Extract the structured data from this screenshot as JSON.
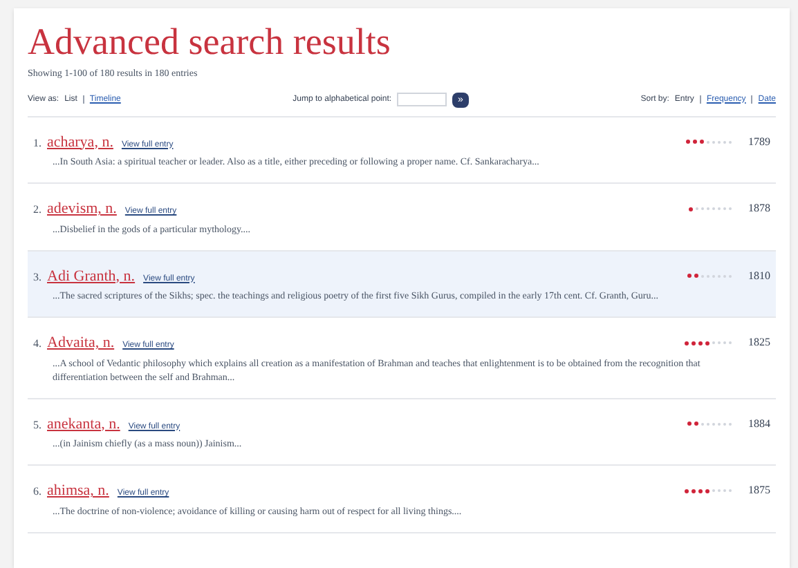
{
  "title": "Advanced search results",
  "summary": "Showing 1-100 of 180 results in 180 entries",
  "view": {
    "label": "View as:",
    "options": [
      {
        "label": "List",
        "selected": true
      },
      {
        "label": "Timeline",
        "selected": false
      }
    ]
  },
  "jump": {
    "label": "Jump to alphabetical point:",
    "button": "»"
  },
  "sort": {
    "label": "Sort by:",
    "options": [
      {
        "label": "Entry",
        "selected": true
      },
      {
        "label": "Frequency",
        "selected": false
      },
      {
        "label": "Date",
        "selected": false
      }
    ]
  },
  "results": [
    {
      "number": "1.",
      "headword": "acharya, n.",
      "link": "View full entry",
      "snippet": "...In South Asia: a spiritual teacher or leader. Also as a title, either preceding or following a proper name. Cf. Sankaracharya...",
      "level": 0.375,
      "date": "1789",
      "highlighted": false
    },
    {
      "number": "2.",
      "headword": "adevism, n.",
      "link": "View full entry",
      "snippet": "...Disbelief in the gods of a particular mythology....",
      "level": 0.125,
      "date": "1878",
      "highlighted": false
    },
    {
      "number": "3.",
      "headword": "Adi Granth, n.",
      "link": "View full entry",
      "snippet": "...The sacred scriptures of the Sikhs; spec. the teachings and religious poetry of the first five Sikh Gurus, compiled in the early 17th cent. Cf. Granth, Guru...",
      "level": 0.25,
      "date": "1810",
      "highlighted": true
    },
    {
      "number": "4.",
      "headword": "Advaita, n.",
      "link": "View full entry",
      "snippet": "...A school of Vedantic philosophy which explains all creation as a manifestation of Brahman and teaches that enlightenment is to be obtained from the recognition that differentiation between the self and Brahman...",
      "level": 0.5,
      "date": "1825",
      "highlighted": false
    },
    {
      "number": "5.",
      "headword": "anekanta, n.",
      "link": "View full entry",
      "snippet": "...(in Jainism chiefly (as a mass noun)) Jainism...",
      "level": 0.25,
      "date": "1884",
      "highlighted": false
    },
    {
      "number": "6.",
      "headword": "ahimsa, n.",
      "link": "View full entry",
      "snippet": "...The doctrine of non-violence; avoidance of killing or causing harm out of respect for all living things....",
      "level": 0.5,
      "date": "1875",
      "highlighted": false
    }
  ]
}
